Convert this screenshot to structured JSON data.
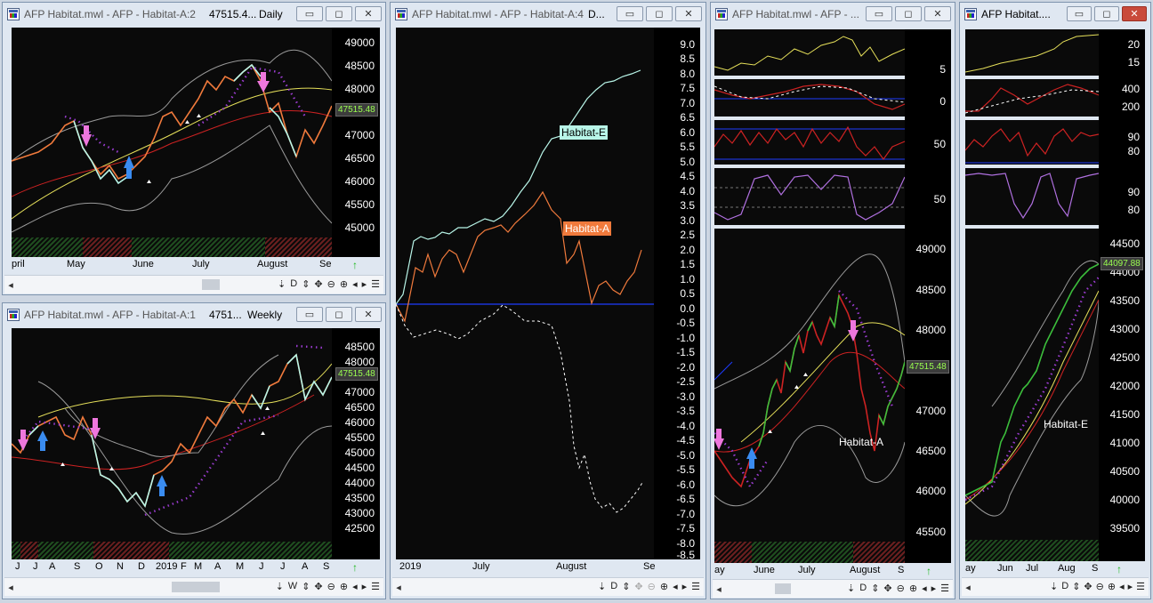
{
  "windows": {
    "w1": {
      "title": "AFP Habitat.mwl - AFP - Habitat-A:2",
      "price_short": "47515.4...",
      "period": "Daily",
      "price_tag": "47515.48",
      "y_ticks": [
        "49000",
        "48500",
        "48000",
        "47500",
        "47000",
        "46500",
        "46000",
        "45500",
        "45000"
      ],
      "x_labels": [
        "pril",
        "May",
        "June",
        "July",
        "August",
        "Se"
      ],
      "nav": [
        "⇣",
        "D",
        "⇕",
        "✥",
        "⊖",
        "⊕",
        "◂",
        "▸",
        "☰"
      ]
    },
    "w2": {
      "title": "AFP Habitat.mwl - AFP - Habitat-A:1",
      "price_short": "4751...",
      "period": "Weekly",
      "price_tag": "47515.48",
      "y_ticks": [
        "48500",
        "48000",
        "47500",
        "47000",
        "46500",
        "46000",
        "45500",
        "45000",
        "44500",
        "44000",
        "43500",
        "43000",
        "42500"
      ],
      "x_labels": [
        "J",
        "J",
        "A",
        "S",
        "O",
        "N",
        "D",
        "2019",
        "F",
        "M",
        "A",
        "M",
        "J",
        "J",
        "A",
        "S"
      ],
      "nav": [
        "⇣",
        "W",
        "⇕",
        "✥",
        "⊖",
        "⊕",
        "◂",
        "▸",
        "☰"
      ]
    },
    "w3": {
      "title": "AFP Habitat.mwl - AFP - Habitat-A:4",
      "period": "D...",
      "y_ticks": [
        "9.0",
        "8.5",
        "8.0",
        "7.5",
        "7.0",
        "6.5",
        "6.0",
        "5.5",
        "5.0",
        "4.5",
        "4.0",
        "3.5",
        "3.0",
        "2.5",
        "2.0",
        "1.5",
        "1.0",
        "0.5",
        "0.0",
        "-0.5",
        "-1.0",
        "-1.5",
        "-2.0",
        "-2.5",
        "-3.0",
        "-3.5",
        "-4.0",
        "-4.5",
        "-5.0",
        "-5.5",
        "-6.0",
        "-6.5",
        "-7.0",
        "-7.5",
        "-8.0",
        "-8.5"
      ],
      "x_labels": [
        "2019",
        "July",
        "August",
        "Se"
      ],
      "label_e": "Habitat-E",
      "label_a": "Habitat-A",
      "nav": [
        "⇣",
        "D",
        "⇕",
        "✥",
        "⊖",
        "⊕",
        "◂",
        "▸",
        "☰"
      ]
    },
    "w4": {
      "title": "AFP Habitat.mwl - AFP - ...",
      "ind_ticks": [
        "5",
        "0",
        "50",
        "50"
      ],
      "y_ticks": [
        "49000",
        "48500",
        "48000",
        "47500",
        "47000",
        "46500",
        "46000",
        "45500"
      ],
      "price_tag": "47515.48",
      "x_labels": [
        "ay",
        "June",
        "July",
        "August",
        "S"
      ],
      "label_a": "Habitat-A",
      "nav": [
        "⇣",
        "D",
        "⇕",
        "✥",
        "⊖",
        "⊕",
        "◂",
        "▸",
        "☰"
      ]
    },
    "w5": {
      "title": "AFP Habitat....",
      "ind_ticks": [
        "20",
        "15",
        "400",
        "200",
        "90",
        "80",
        "90",
        "80"
      ],
      "y_ticks": [
        "44500",
        "44000",
        "43500",
        "43000",
        "42500",
        "42000",
        "41500",
        "41000",
        "40500",
        "40000",
        "39500"
      ],
      "price_tag": "44097.88",
      "x_labels": [
        "ay",
        "Jun",
        "Jul",
        "Aug",
        "S"
      ],
      "label_e": "Habitat-E",
      "nav": [
        "⇣",
        "D",
        "⇕",
        "✥",
        "⊖",
        "⊕",
        "◂",
        "▸",
        "☰"
      ]
    }
  },
  "colors": {
    "bg": "#0a0a0a",
    "habitat_e": "#b8f5e8",
    "habitat_a": "#f07a3c",
    "zero_line": "#1e3cff",
    "bollinger": "#9a9a9a",
    "ma_yellow": "#e6e05a",
    "ma_red": "#cc2222",
    "psar": "#9a3cd0",
    "signal_down": "#ee77dd",
    "signal_up": "#3a8cf0"
  }
}
